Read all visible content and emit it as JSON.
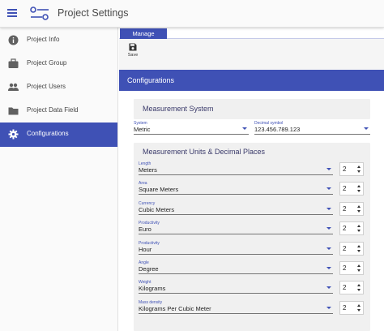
{
  "app": {
    "title": "Project Settings"
  },
  "colors": {
    "accent": "#3f51b5",
    "sidebar_bg": "#fafafa",
    "card_bg": "#f0f0f0"
  },
  "sidebar": {
    "items": [
      {
        "label": "Project Info",
        "icon": "info-icon",
        "active": false
      },
      {
        "label": "Project Group",
        "icon": "briefcase-icon",
        "active": false
      },
      {
        "label": "Project Users",
        "icon": "people-icon",
        "active": false
      },
      {
        "label": "Project Data Field",
        "icon": "folder-icon",
        "active": false
      },
      {
        "label": "Configurations",
        "icon": "gear-icon",
        "active": true
      }
    ]
  },
  "tabs": [
    {
      "label": "Manage",
      "active": true
    }
  ],
  "toolbar": {
    "save_label": "Save",
    "save_icon": "save-icon"
  },
  "section": {
    "title": "Configurations"
  },
  "measurement_system": {
    "title": "Measurement System",
    "system": {
      "label": "System",
      "value": "Metric"
    },
    "decimal_symbol": {
      "label": "Decimal symbol",
      "value": "123.456.789.123"
    }
  },
  "units": {
    "title": "Measurement Units & Decimal Places",
    "rows": [
      {
        "label": "Length",
        "value": "Meters",
        "decimals": "2"
      },
      {
        "label": "Area",
        "value": "Square Meters",
        "decimals": "2"
      },
      {
        "label": "Currency",
        "value": "Cubic Meters",
        "decimals": "2"
      },
      {
        "label": "Productivity",
        "value": "Euro",
        "decimals": "2"
      },
      {
        "label": "Productivity",
        "value": "Hour",
        "decimals": "2"
      },
      {
        "label": "Angle",
        "value": "Degree",
        "decimals": "2"
      },
      {
        "label": "Weight",
        "value": "Kilograms",
        "decimals": "2"
      },
      {
        "label": "Mass density",
        "value": "Kilograms Per Cubic Meter",
        "decimals": "2"
      }
    ]
  }
}
